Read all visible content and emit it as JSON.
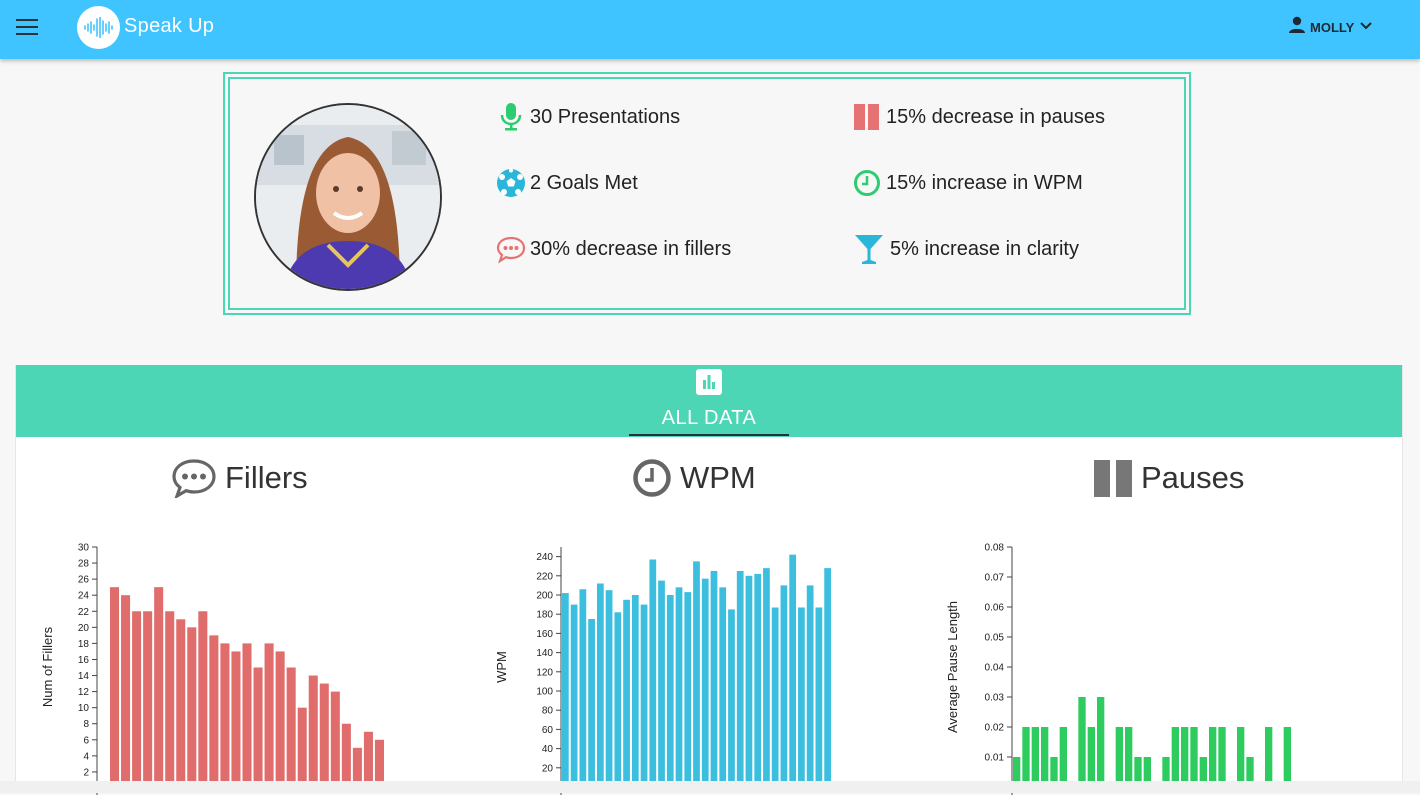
{
  "header": {
    "app_title": "Speak Up",
    "user_name": "MOLLY",
    "icons": {
      "menu": "hamburger-menu-icon",
      "logo": "soundwave-logo-icon",
      "user": "person-icon",
      "dropdown": "chevron-down-icon"
    }
  },
  "summary": {
    "stats": [
      {
        "text": "30 Presentations",
        "icon": "microphone-icon",
        "color": "#2ecc71"
      },
      {
        "text": "2 Goals Met",
        "icon": "soccer-ball-icon",
        "color": "#29b6d8"
      },
      {
        "text": "30% decrease in fillers",
        "icon": "speech-bubble-icon",
        "color": "#e57373"
      },
      {
        "text": "15% decrease in pauses",
        "icon": "pause-icon",
        "color": "#e57373"
      },
      {
        "text": "15% increase in WPM",
        "icon": "clock-icon",
        "color": "#2ecc71"
      },
      {
        "text": "5% increase in clarity",
        "icon": "cocktail-glass-icon",
        "color": "#29b6d8"
      }
    ]
  },
  "tabs": [
    {
      "label": "ALL DATA",
      "icon": "bar-chart-icon",
      "active": true
    }
  ],
  "colors": {
    "accent": "#4dd6b5",
    "header": "#40c4ff",
    "fillers": "#e06c6c",
    "wpm": "#3cbfdf",
    "pauses": "#2ecc5f"
  },
  "charts": {
    "fillers": {
      "title": "Fillers",
      "icon": "speech-bubble-icon"
    },
    "wpm": {
      "title": "WPM",
      "icon": "clock-icon"
    },
    "pauses": {
      "title": "Pauses",
      "icon": "pause-icon"
    }
  },
  "chart_data": [
    {
      "type": "bar",
      "title": "Fillers",
      "xlabel": "",
      "ylabel": "Num of Fillers",
      "ylim": [
        0,
        30
      ],
      "yticks": [
        2,
        4,
        6,
        8,
        10,
        12,
        14,
        16,
        18,
        20,
        22,
        24,
        26,
        28,
        30
      ],
      "values": [
        25,
        24,
        22,
        22,
        25,
        22,
        21,
        20,
        22,
        19,
        18,
        17,
        18,
        15,
        18,
        17,
        15,
        10,
        14,
        13,
        12,
        8,
        5,
        7,
        6
      ]
    },
    {
      "type": "bar",
      "title": "WPM",
      "xlabel": "",
      "ylabel": "WPM",
      "ylim": [
        0,
        250
      ],
      "yticks": [
        20,
        40,
        60,
        80,
        100,
        120,
        140,
        160,
        180,
        200,
        220,
        240
      ],
      "values": [
        202,
        190,
        206,
        175,
        212,
        205,
        182,
        195,
        200,
        190,
        237,
        215,
        200,
        208,
        203,
        235,
        217,
        225,
        208,
        185,
        225,
        220,
        222,
        228,
        187,
        210,
        242,
        187,
        210,
        187,
        228
      ]
    },
    {
      "type": "bar",
      "title": "Pauses",
      "xlabel": "",
      "ylabel": "Average Pause Length",
      "ylim": [
        0,
        0.08
      ],
      "yticks": [
        0.01,
        0.02,
        0.03,
        0.04,
        0.05,
        0.06,
        0.07,
        0.08
      ],
      "values": [
        0.01,
        0.02,
        0.02,
        0.02,
        0.01,
        0.02,
        0,
        0.03,
        0.02,
        0.03,
        0,
        0.02,
        0.02,
        0.01,
        0.01,
        0,
        0.01,
        0.02,
        0.02,
        0.02,
        0.01,
        0.02,
        0.02,
        0,
        0.02,
        0.01,
        0,
        0.02,
        0,
        0.02
      ]
    }
  ]
}
